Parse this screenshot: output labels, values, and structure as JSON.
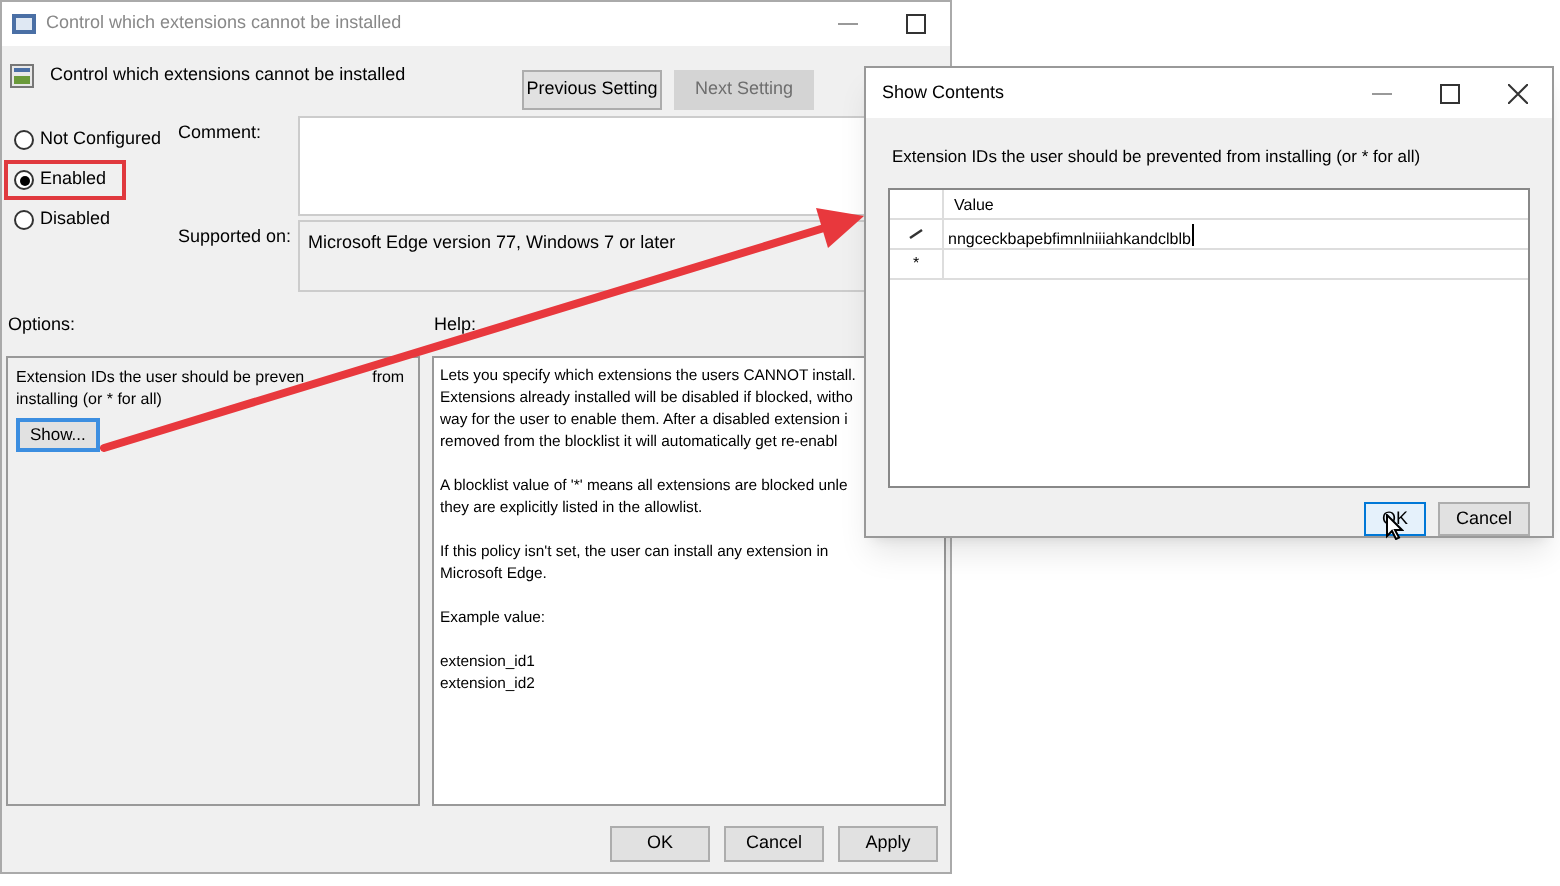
{
  "main_window": {
    "title": "Control which extensions cannot be installed",
    "policy_name": "Control which extensions cannot be installed",
    "nav_buttons": [
      {
        "label": "Previous Setting",
        "disabled": false
      },
      {
        "label": "Next Setting",
        "disabled": true
      }
    ],
    "radios": [
      {
        "label": "Not Configured",
        "selected": false,
        "highlighted": false
      },
      {
        "label": "Enabled",
        "selected": true,
        "highlighted": true
      },
      {
        "label": "Disabled",
        "selected": false,
        "highlighted": false
      }
    ],
    "comment": {
      "label": "Comment:"
    },
    "supported_on": {
      "label": "Supported on:",
      "value": "Microsoft Edge version 77, Windows 7 or later"
    },
    "options": {
      "label": "Options:",
      "description_parts": [
        "Extension IDs the user should be preven",
        "from",
        "installing (or * for all)"
      ],
      "button": "Show..."
    },
    "help": {
      "label": "Help:",
      "paragraphs": [
        [
          "Lets you specify which extensions the users CANNOT install.",
          "Extensions already installed will be disabled if blocked, witho",
          "way for the user to enable them. After a disabled extension i",
          "removed from the blocklist it will automatically get re-enabl"
        ],
        [
          "A blocklist value of '*' means all extensions are blocked unle",
          "they are explicitly listed in the allowlist."
        ],
        [
          "If this policy isn't set, the user can install any extension in",
          "Microsoft Edge."
        ],
        [
          "Example value:"
        ],
        [
          "extension_id1",
          "extension_id2"
        ]
      ]
    },
    "buttons": [
      "OK",
      "Cancel",
      "Apply"
    ]
  },
  "dialog": {
    "title": "Show Contents",
    "prompt": "Extension IDs the user should be prevented from installing (or * for all)",
    "table": {
      "columns": [
        "Value"
      ],
      "rows": [
        {
          "kind": "edit",
          "value": "nngceckbapebfimnlniiiahkandclblb"
        },
        {
          "kind": "new",
          "marker": "*"
        }
      ]
    },
    "buttons": [
      {
        "label": "OK",
        "selected": true
      },
      {
        "label": "Cancel",
        "selected": false
      }
    ]
  }
}
